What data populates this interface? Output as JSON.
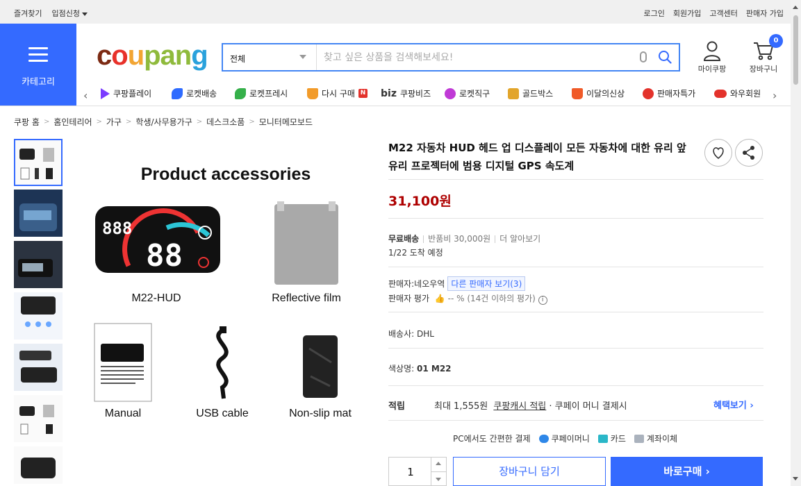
{
  "topbar": {
    "left": [
      "즐겨찾기",
      "입점신청"
    ],
    "right": [
      "로그인",
      "회원가입",
      "고객센터",
      "판매자 가입"
    ]
  },
  "category_label": "카테고리",
  "logo": [
    "c",
    "o",
    "u",
    "pan",
    "g"
  ],
  "search": {
    "scope": "전체",
    "placeholder": "찾고 싶은 상품을 검색해보세요!"
  },
  "header_icons": {
    "mypage": "마이쿠팡",
    "cart": "장바구니",
    "cart_count": "0"
  },
  "nav": [
    {
      "label": "쿠팡플레이",
      "color": "#7b3cff"
    },
    {
      "label": "로켓배송",
      "color": "#2e6bff"
    },
    {
      "label": "로켓프레시",
      "color": "#35b04a"
    },
    {
      "label": "다시 구매",
      "color": "#f29b2a"
    },
    {
      "label": "쿠팡비즈",
      "color": "#333333"
    },
    {
      "label": "로켓직구",
      "color": "#c03ad6"
    },
    {
      "label": "골드박스",
      "color": "#e2a52b"
    },
    {
      "label": "이달의신상",
      "color": "#f05a28"
    },
    {
      "label": "판매자특가",
      "color": "#e3322b"
    },
    {
      "label": "와우회원",
      "color": "#e3322b"
    }
  ],
  "nav_extra": {
    "biz": "biz",
    "new_badge": "N"
  },
  "breadcrumb": [
    "쿠팡 홈",
    "홈인테리어",
    "가구",
    "학생/사무용가구",
    "데스크소품",
    "모니터메모보드"
  ],
  "main_image": {
    "heading": "Product accessories",
    "captions": [
      "M22-HUD",
      "Reflective film",
      "Manual",
      "USB cable",
      "Non-slip mat"
    ],
    "screen_small": "888",
    "screen_big": "88"
  },
  "product": {
    "title": "M22 자동차 HUD 헤드 업 디스플레이 모든 자동차에 대한 유리 앞 유리 프로젝터에 범용 디지털 GPS 속도계",
    "price": "31,100원",
    "shipping_free": "무료배송",
    "return_fee": "반품비 30,000원",
    "more": "더 알아보기",
    "eta": "1/22 도착 예정",
    "seller_label": "판매자:",
    "seller_name": "네오우역",
    "other_sellers": "다른 판매자 보기(3)",
    "rating_label": "판매자 평가",
    "rating_value": "-- % (14건 이하의 평가)",
    "carrier_label": "배송사:",
    "carrier": "DHL",
    "color_label": "색상명:",
    "color_value": "01 M22",
    "reward_label": "적립",
    "reward_text_1": "최대 1,555원",
    "reward_link": "쿠팡캐시 적립",
    "reward_text_2": "· 쿠페이 머니 결제시",
    "benefit_link": "혜택보기",
    "pay_intro": "PC에서도 간편한 결제",
    "pay_methods": [
      "쿠페이머니",
      "카드",
      "계좌이체"
    ],
    "quantity": "1",
    "add_to_cart": "장바구니 담기",
    "buy_now": "바로구매"
  }
}
